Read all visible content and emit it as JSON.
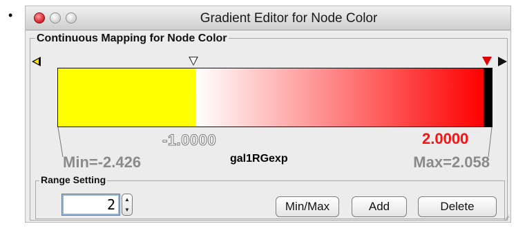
{
  "window": {
    "title": "Gradient Editor for Node Color"
  },
  "mapping": {
    "group_label": "Continuous Mapping for Node Color",
    "attribute": "gal1RGexp",
    "min_label": "Min=-2.426",
    "max_label": "Max=2.058",
    "point_left_value": "-1.0000",
    "point_right_value": "2.0000",
    "colors": {
      "below": "#ffff00",
      "start": "#ffffff",
      "end": "#ff0000",
      "above": "#000000"
    }
  },
  "range_setting": {
    "group_label": "Range Setting",
    "spinner_value": "2",
    "buttons": {
      "minmax": "Min/Max",
      "add": "Add",
      "delete": "Delete"
    }
  },
  "icons": {
    "close": "close-icon",
    "minimize": "minimize-icon",
    "zoom": "zoom-icon",
    "left_handle": "triangle-left-icon",
    "right_handle": "triangle-right-icon",
    "marker_white": "triangle-down-white-icon",
    "marker_red": "triangle-down-red-icon",
    "stepper": "stepper-arrows-icon",
    "resize": "resize-grip-icon"
  }
}
